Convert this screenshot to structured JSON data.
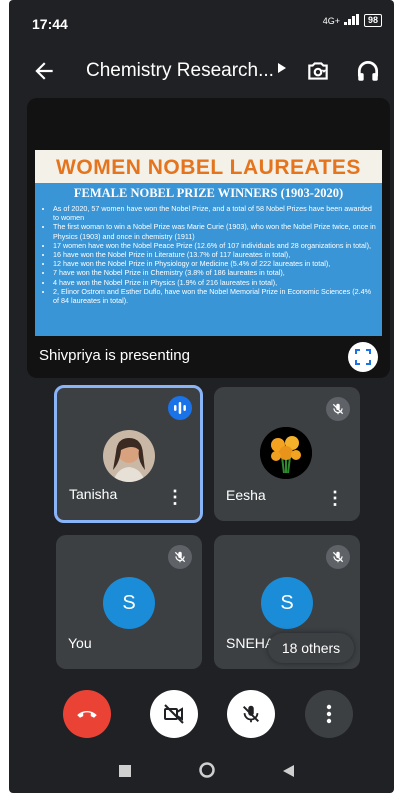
{
  "status_bar": {
    "time": "17:44",
    "network": "4G+",
    "battery": "98"
  },
  "app_bar": {
    "title": "Chemistry Research..."
  },
  "presentation": {
    "slide_title": "WOMEN NOBEL LAUREATES",
    "slide_subtitle": "FEMALE NOBEL PRIZE WINNERS (1903-2020)",
    "bullets": [
      "As of 2020, 57 women have won the Nobel Prize, and a total of 58 Nobel Prizes have been awarded to women",
      "The first woman to win a Nobel Prize was Marie Curie (1903), who won the Nobel Prize twice, once in Physics (1903) and once in chemistry (1911)",
      "17 women have won the Nobel Peace Prize (12.6% of 107 individuals and 28 organizations in total),",
      "16 have won the Nobel Prize in Literature (13.7% of 117 laureates in total),",
      "12 have won the Nobel Prize in Physiology or Medicine (5.4% of 222 laureates in total),",
      "7 have won the Nobel Prize in Chemistry (3.8% of 186 laureates in total),",
      "4 have won the Nobel Prize in Physics (1.9% of 216 laureates in total),",
      "2, Elinor Ostrom and Esther Duflo, have won the Nobel Memorial Prize in Economic Sciences (2.4% of 84 laureates in total)."
    ],
    "presenter_label": "Shivpriya is presenting"
  },
  "participants": [
    {
      "name": "Tanisha",
      "speaking": true
    },
    {
      "name": "Eesha",
      "muted": true
    },
    {
      "name": "You",
      "initial": "S",
      "muted": true
    },
    {
      "name": "SNEHA",
      "initial": "S",
      "muted": true
    }
  ],
  "others_label": "18 others",
  "colors": {
    "accent": "#8ab4f8",
    "end_call": "#ea4335",
    "avatar": "#1a8cd8",
    "slide_title": "#e4741d",
    "slide_bg": "#3a95d6"
  }
}
